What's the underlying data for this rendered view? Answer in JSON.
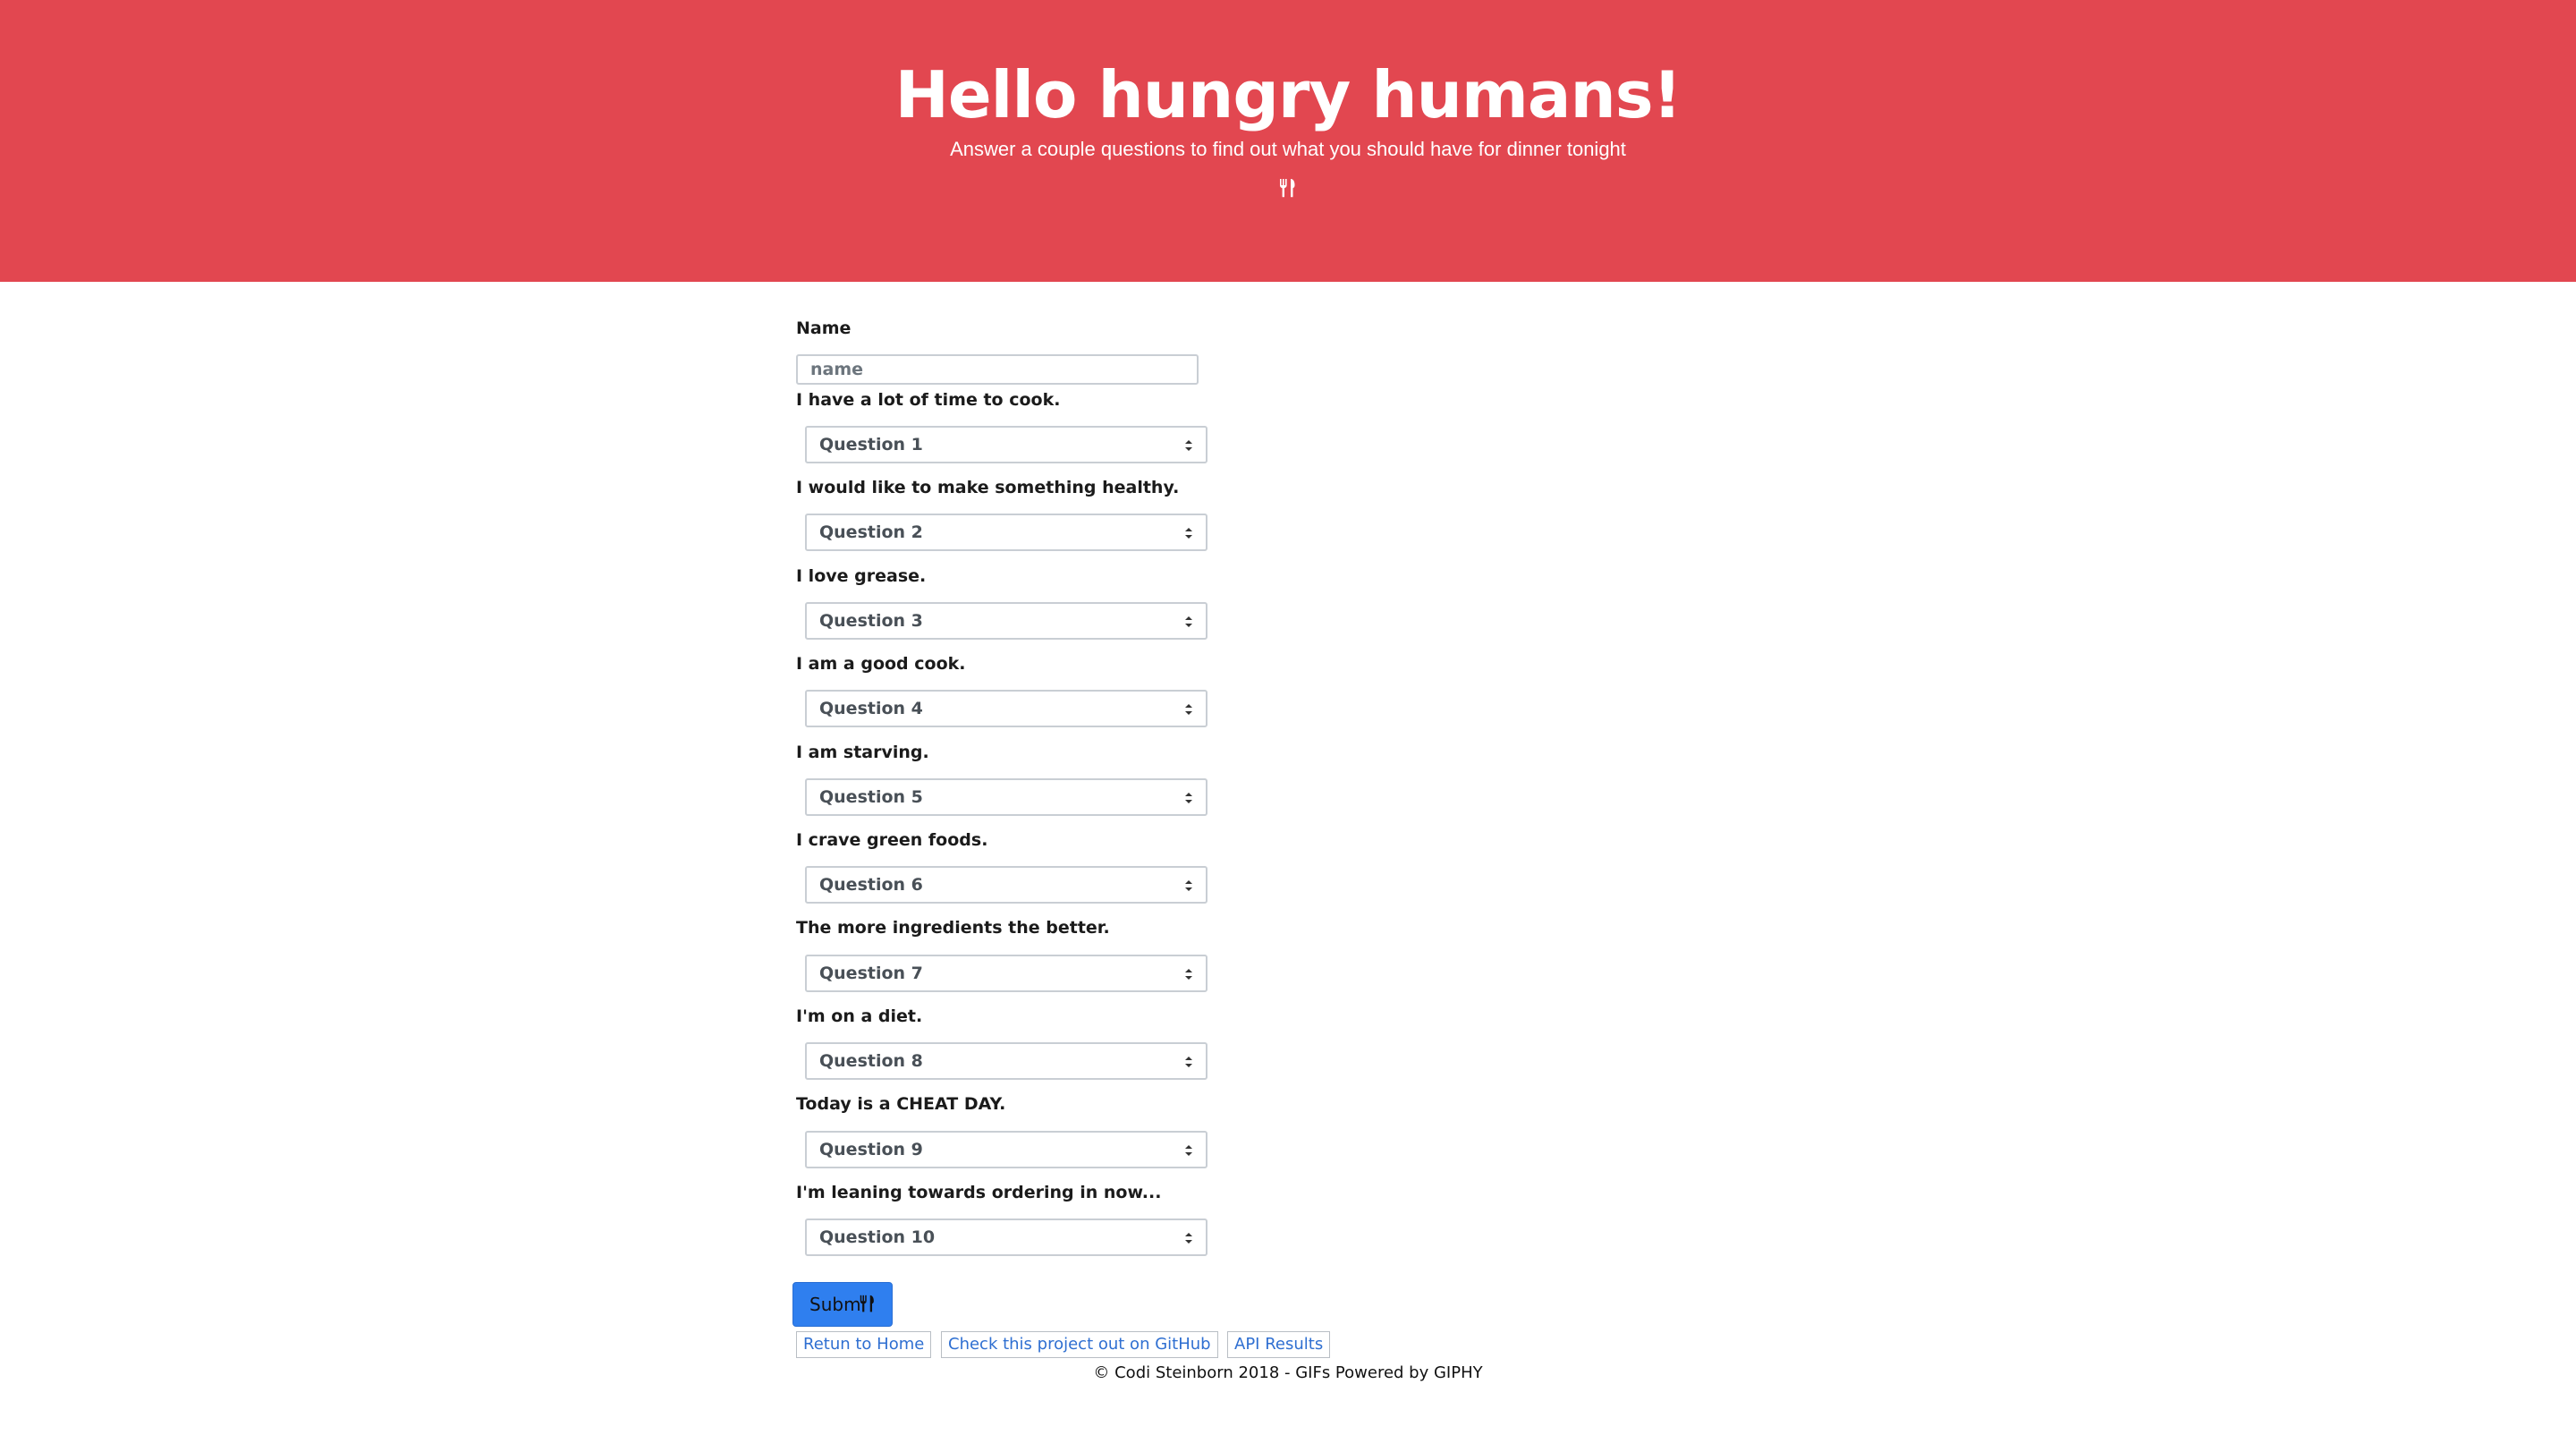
{
  "hero": {
    "title": "Hello hungry humans!",
    "subtitle": "Answer a couple questions to find out what you should have for dinner tonight",
    "icon": "utensils-icon",
    "background_color": "#e24750"
  },
  "form": {
    "name_label": "Name",
    "name_placeholder": "name",
    "questions": [
      {
        "label": "I have a lot of time to cook.",
        "selected": "Question 1"
      },
      {
        "label": "I would like to make something healthy.",
        "selected": "Question 2"
      },
      {
        "label": "I love grease.",
        "selected": "Question 3"
      },
      {
        "label": "I am a good cook.",
        "selected": "Question 4"
      },
      {
        "label": "I am starving.",
        "selected": "Question 5"
      },
      {
        "label": "I crave green foods.",
        "selected": "Question 6"
      },
      {
        "label": "The more ingredients the better.",
        "selected": "Question 7"
      },
      {
        "label": "I'm on a diet.",
        "selected": "Question 8"
      },
      {
        "label": "Today is a CHEAT DAY.",
        "selected": "Question 9"
      },
      {
        "label": "I'm leaning towards ordering in now...",
        "selected": "Question 10"
      }
    ],
    "submit_label": "Subm",
    "submit_color": "#2f7fef"
  },
  "links": {
    "home": "Retun to Home",
    "github": "Check this project out on GitHub",
    "api": "API Results"
  },
  "footer": {
    "text": "© Codi Steinborn 2018 - GIFs Powered by GIPHY"
  }
}
